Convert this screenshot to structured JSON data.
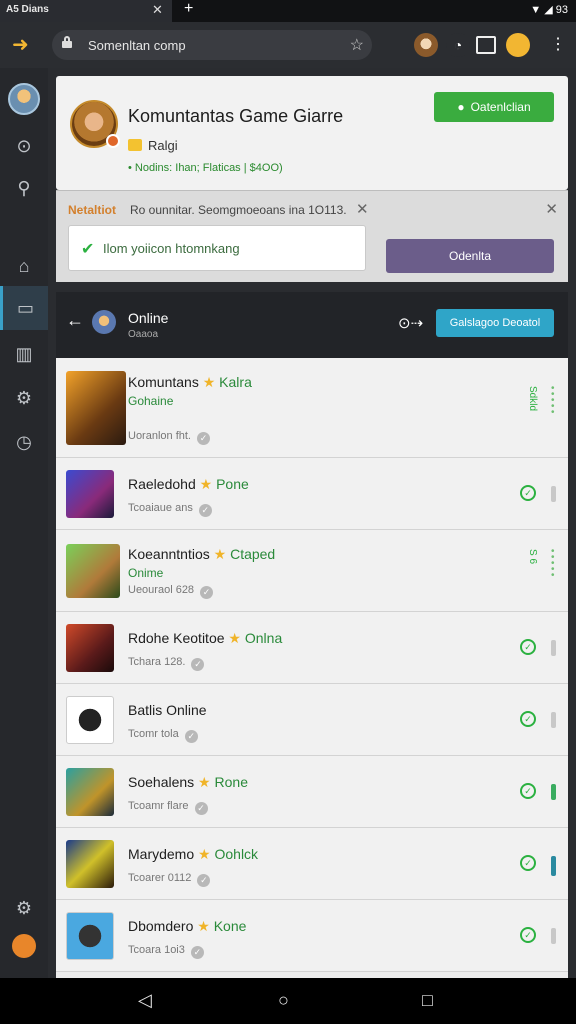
{
  "browser": {
    "tab_title": "A5 Dians",
    "tab_close": "✕",
    "new_tab": "+",
    "status_time": "93",
    "url": "Somenltan comp",
    "back_icon": "back-arrow-icon"
  },
  "profile": {
    "title": "Komuntantas Game Giarre",
    "level": "Ralgi",
    "status": "• Nodins: Ihan; Flaticas | $4OO)",
    "button_label": "Oatenlclian"
  },
  "notification": {
    "label": "Netaltiot",
    "text": "Ro ounnitar. Seomgmoeoans ina 1O113.",
    "input_value": "Ilom yoiicon htomnkang",
    "button_label": "Odenlta"
  },
  "list": {
    "title": "Online",
    "subtitle": "Oaaoa",
    "action_label": "Galslagoo Deoatol",
    "rows": [
      {
        "name": "Komuntans",
        "tag": "Kalra",
        "sub": "Gohaine",
        "meta": "Uoranlon fht.",
        "side": "Sdkld",
        "style": "tall"
      },
      {
        "name": "Raeledohd",
        "tag": "Pone",
        "sub": "",
        "meta": "Tcoaiaue ans",
        "side": "",
        "style": "short"
      },
      {
        "name": "Koeanntntios",
        "tag": "Ctaped",
        "sub": "Onime",
        "meta": "Ueouraol 628",
        "side": "S 6",
        "style": "tall"
      },
      {
        "name": "Rdohe Keotitoe",
        "tag": "Onlna",
        "sub": "",
        "meta": "Tchara 128.",
        "side": "",
        "style": "short"
      },
      {
        "name": "Batlis Online",
        "tag": "",
        "sub": "",
        "meta": "Tcomr tola",
        "side": "",
        "style": "short"
      },
      {
        "name": "Soehalens",
        "tag": "Rone",
        "sub": "",
        "meta": "Tcoamr flare",
        "side": "",
        "style": "short"
      },
      {
        "name": "Marydemo",
        "tag": "Oohlck",
        "sub": "",
        "meta": "Tcoarer 0112",
        "side": "",
        "style": "short"
      },
      {
        "name": "Dbomdero",
        "tag": "Kone",
        "sub": "",
        "meta": "Tcoara 1oi3",
        "side": "",
        "style": "short"
      }
    ]
  },
  "colors": {
    "accent_green": "#3aac3f",
    "accent_blue": "#2fa5c8",
    "accent_purple": "#6b5d8a",
    "warning_orange": "#d3802d"
  }
}
